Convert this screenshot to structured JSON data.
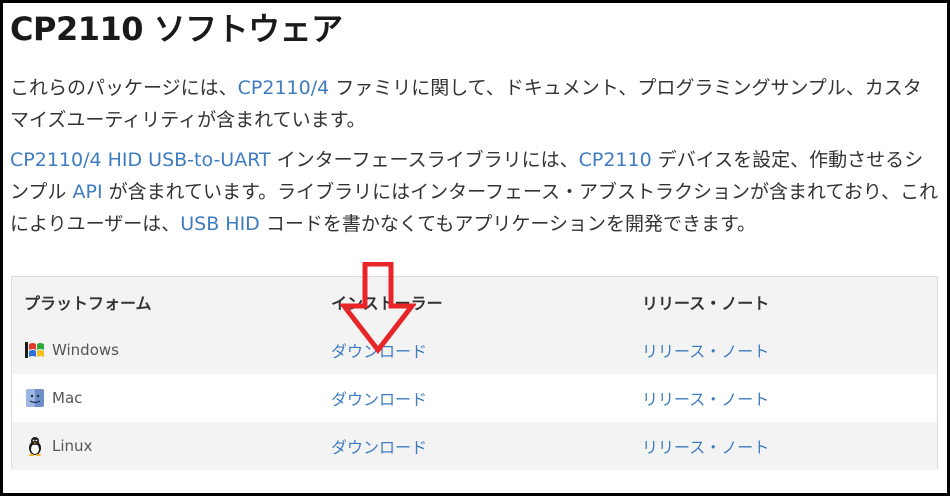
{
  "page": {
    "title": "CP2110 ソフトウェア"
  },
  "intro": {
    "p1_a": "これらのパッケージには、",
    "p1_b": "CP2110/4",
    "p1_c": " ファミリに関して、ドキュメント、プログラミングサンプル、カスタマイズユーティリティが含まれています。",
    "p2_a": "CP2110/4 HID USB-to-UART",
    "p2_b": " インターフェースライブラリには、",
    "p2_c": "CP2110",
    "p2_d": " デバイスを設定、作動させるシンプル ",
    "p2_e": "API",
    "p2_f": " が含まれています。ライブラリにはインターフェース・アブストラクションが含まれており、これによりユーザーは、",
    "p2_g": "USB HID",
    "p2_h": " コードを書かなくてもアプリケーションを開発できます。"
  },
  "table": {
    "headers": {
      "platform": "プラットフォーム",
      "installer": "インストーラー",
      "release_notes": "リリース・ノート"
    },
    "rows": [
      {
        "platform": "Windows",
        "installer": "ダウンロード",
        "release_notes": "リリース・ノート",
        "icon": "windows-icon"
      },
      {
        "platform": "Mac",
        "installer": "ダウンロード",
        "release_notes": "リリース・ノート",
        "icon": "mac-icon"
      },
      {
        "platform": "Linux",
        "installer": "ダウンロード",
        "release_notes": "リリース・ノート",
        "icon": "linux-icon"
      }
    ]
  },
  "colors": {
    "link": "#3f7cbf",
    "annotation_arrow": "#e8262a",
    "table_stripe": "#f3f3f3"
  }
}
